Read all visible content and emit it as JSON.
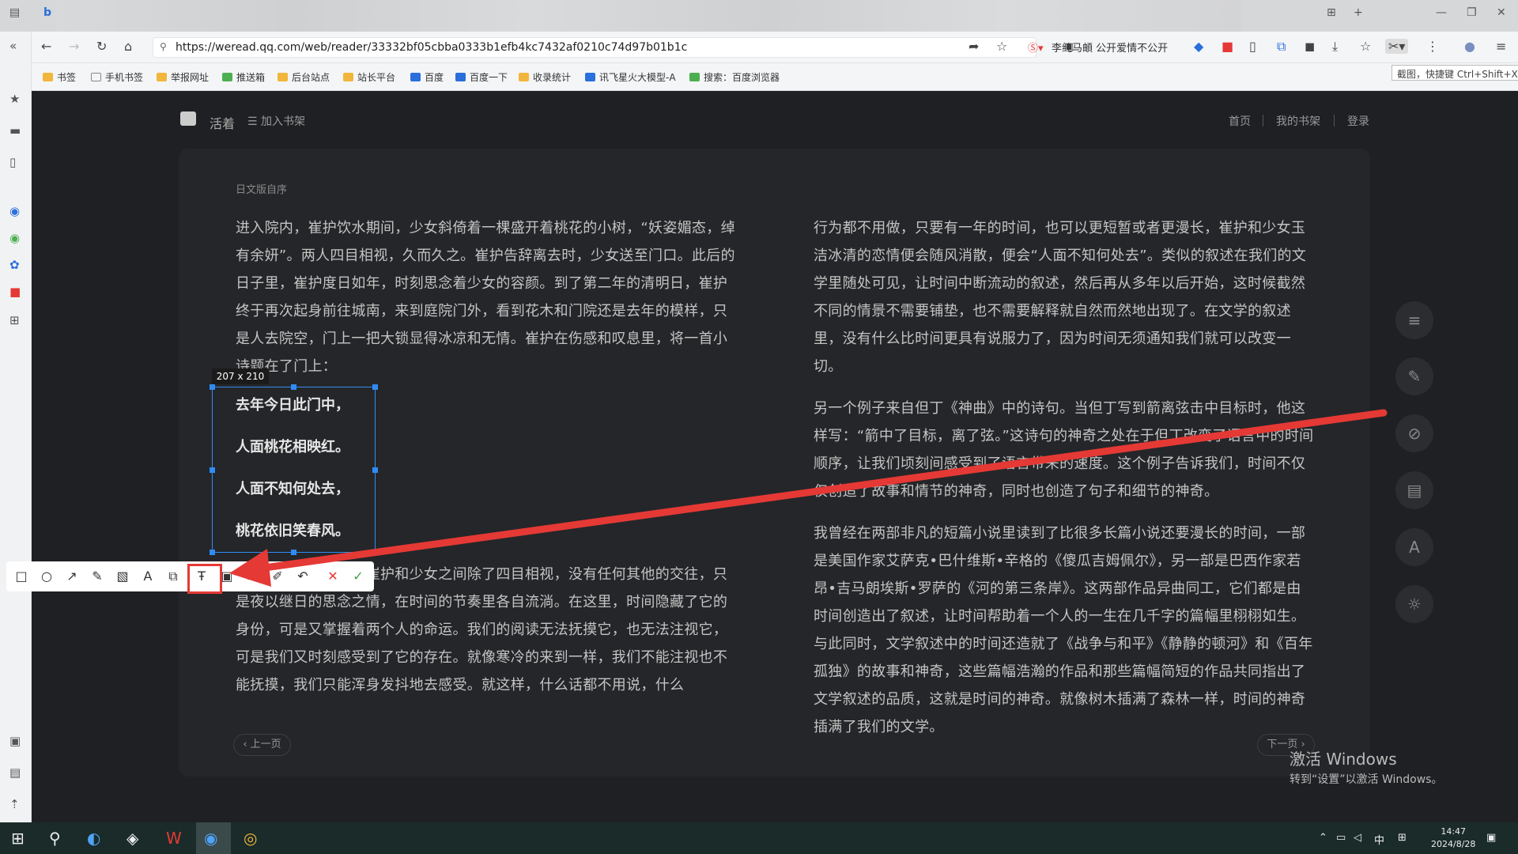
{
  "browser": {
    "url": "https://weread.qq.com/web/reader/33332bf05cbba0333b1efb4kc7432af0210c74d97b01b1c",
    "news_ticker": "李纯马頔 公开爱情不公开",
    "tooltip": "截图，快捷键 Ctrl+Shift+X",
    "bookmarks": [
      "书签",
      "手机书签",
      "举报网址",
      "推送箱",
      "后台站点",
      "站长平台",
      "百度",
      "百度一下",
      "收录统计",
      "讯飞星火大模型-A",
      "搜索：百度浏览器"
    ]
  },
  "reader": {
    "title": "活着",
    "add_shelf": "加入书架",
    "nav": [
      "首页",
      "我的书架",
      "登录"
    ],
    "chapter": "日文版自序",
    "left_paragraphs": [
      "进入院内，崔护饮水期间，少女斜倚着一棵盛开着桃花的小树，“妖姿媚态，绰有余妍”。两人四目相视，久而久之。崔护告辞离去时，少女送至门口。此后的日子里，崔护度日如年，时刻思念着少女的容颜。到了第二年的清明日，崔护终于再次起身前往城南，来到庭院门外，看到花木和门院还是去年的模样，只是人去院空，门上一把大锁显得冰凉和无情。崔护在伤感和叹息里，将一首小诗题在了门上："
    ],
    "poem": [
      "去年今日此门中，",
      "人面桃花相映红。",
      "人面不知何处去，",
      "桃花依旧笑春风。"
    ],
    "left_after_poem": "这首诗的意味深长。崔护和少女之间除了四目相视，没有任何其他的交往，只是夜以继日的思念之情，在时间的节奏里各自流淌。在这里，时间隐藏了它的身份，可是又掌握着两个人的命运。我们的阅读无法抚摸它，也无法注视它，可是我们又时刻感受到了它的存在。就像寒冷的来到一样，我们不能注视也不能抚摸，我们只能浑身发抖地去感受。就这样，什么话都不用说，什么",
    "right_paragraphs": [
      "行为都不用做，只要有一年的时间，也可以更短暂或者更漫长，崔护和少女玉洁冰清的恋情便会随风消散，便会“人面不知何处去”。类似的叙述在我们的文学里随处可见，让时间中断流动的叙述，然后再从多年以后开始，这时候截然不同的情景不需要铺垫，也不需要解释就自然而然地出现了。在文学的叙述里，没有什么比时间更具有说服力了，因为时间无须通知我们就可以改变一切。",
      "另一个例子来自但丁《神曲》中的诗句。当但丁写到箭离弦击中目标时，他这样写：“箭中了目标，离了弦。”这诗句的神奇之处在于但丁改变了语言中的时间顺序，让我们顷刻间感受到了语言带来的速度。这个例子告诉我们，时间不仅仅创造了故事和情节的神奇，同时也创造了句子和细节的神奇。",
      "我曾经在两部非凡的短篇小说里读到了比很多长篇小说还要漫长的时间，一部是美国作家艾萨克•巴什维斯•辛格的《傻瓜吉姆佩尔》，另一部是巴西作家若昂•吉马朗埃斯•罗萨的《河的第三条岸》。这两部作品异曲同工，它们都是由时间创造出了叙述，让时间帮助着一个人的一生在几千字的篇幅里栩栩如生。与此同时，文学叙述中的时间还造就了《战争与和平》《静静的顿河》和《百年孤独》的故事和神奇，这些篇幅浩瀚的作品和那些篇幅简短的作品共同指出了文学叙述的品质，这就是时间的神奇。就像树木插满了森林一样，时间的神奇插满了我们的文学。"
    ],
    "prev": "上一页",
    "next": "下一页"
  },
  "screenshot": {
    "size_label": "207 x 210"
  },
  "watermark": {
    "line1": "激活 Windows",
    "line2": "转到“设置”以激活 Windows。"
  },
  "taskbar": {
    "time": "14:47",
    "date": "2024/8/28",
    "ime": "中"
  },
  "colors": {
    "accent_blue": "#2f8cf5",
    "annotation_red": "#e53935",
    "page_bg": "#252629"
  }
}
